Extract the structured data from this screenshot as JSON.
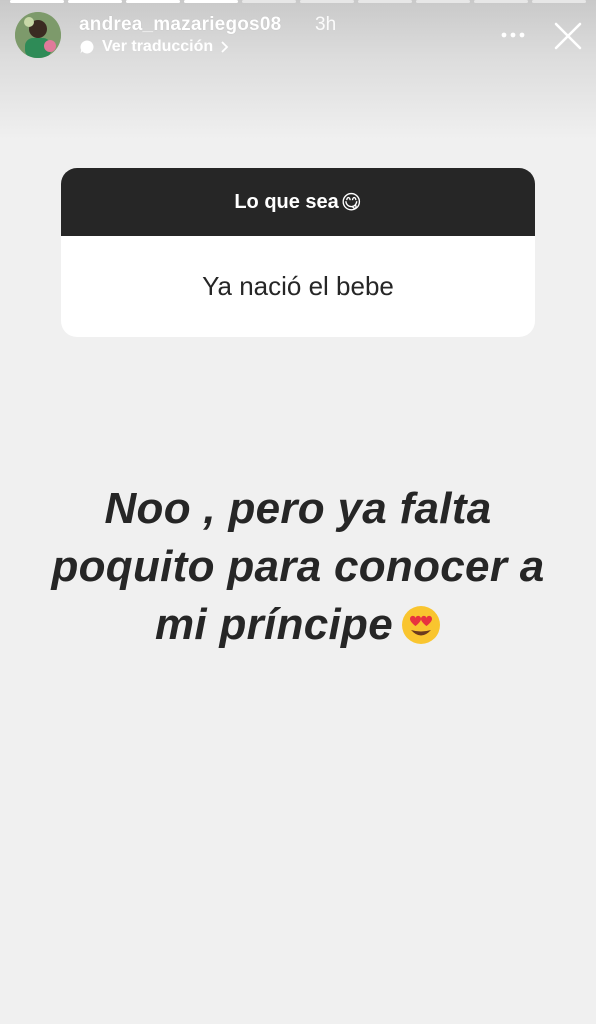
{
  "story": {
    "progress_segments": 10,
    "progress_completed": 4
  },
  "header": {
    "username": "andrea_mazariegos08",
    "time_ago": "3h",
    "translate_label": "Ver traducción",
    "icons": [
      "avatar",
      "translate-bubble-icon",
      "chevron-right-icon",
      "more-icon",
      "close-icon"
    ]
  },
  "question_sticker": {
    "prompt": "Lo que sea",
    "prompt_emoji": "😋",
    "response": "Ya nació el bebe"
  },
  "answer": {
    "text": "Noo , pero ya falta poquito para conocer a mi príncipe",
    "emoji": "😍"
  },
  "colors": {
    "background": "#f0f0f0",
    "sticker_header": "#262626",
    "text": "#262626"
  }
}
